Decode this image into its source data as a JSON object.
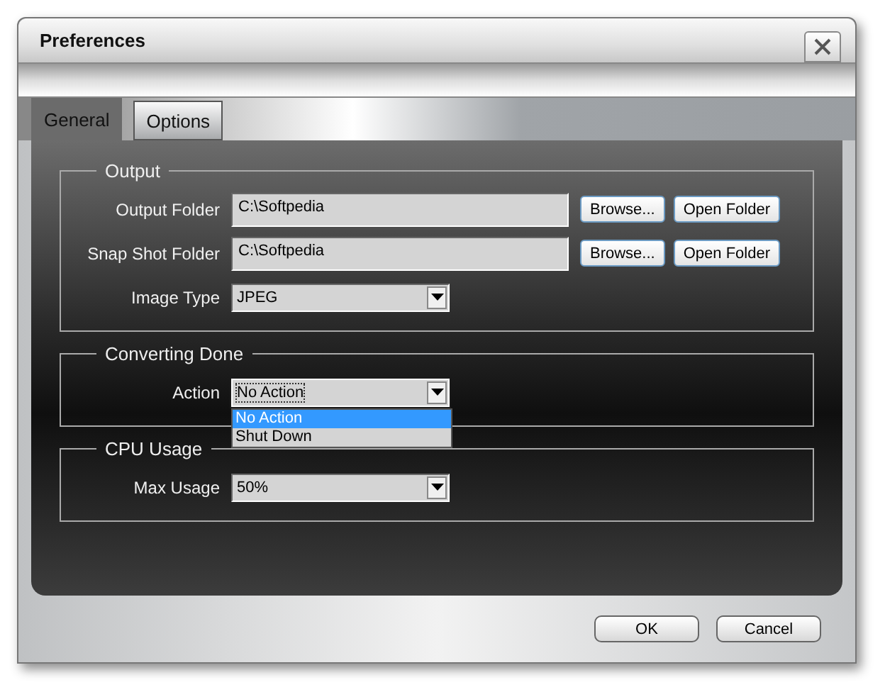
{
  "window": {
    "title": "Preferences"
  },
  "tabs": [
    {
      "label": "General",
      "selected": true
    },
    {
      "label": "Options",
      "selected": false
    }
  ],
  "groups": [
    {
      "title": "Output",
      "rows": [
        {
          "kind": "path",
          "label": "Output Folder",
          "value": "C:\\Softpedia",
          "buttons": [
            "Browse...",
            "Open Folder"
          ]
        },
        {
          "kind": "path",
          "label": "Snap Shot Folder",
          "value": "C:\\Softpedia",
          "buttons": [
            "Browse...",
            "Open Folder"
          ]
        },
        {
          "kind": "select",
          "label": "Image Type",
          "value": "JPEG"
        }
      ]
    },
    {
      "title": "Converting Done",
      "rows": [
        {
          "kind": "select",
          "label": "Action",
          "value": "No Action",
          "expanded": true,
          "options": [
            {
              "label": "No Action",
              "selected": true
            },
            {
              "label": "Shut Down",
              "selected": false
            }
          ]
        }
      ]
    },
    {
      "title": "CPU Usage",
      "rows": [
        {
          "kind": "select",
          "label": "Max Usage",
          "value": "50%"
        }
      ]
    }
  ],
  "buttons": [
    "OK",
    "Cancel"
  ]
}
